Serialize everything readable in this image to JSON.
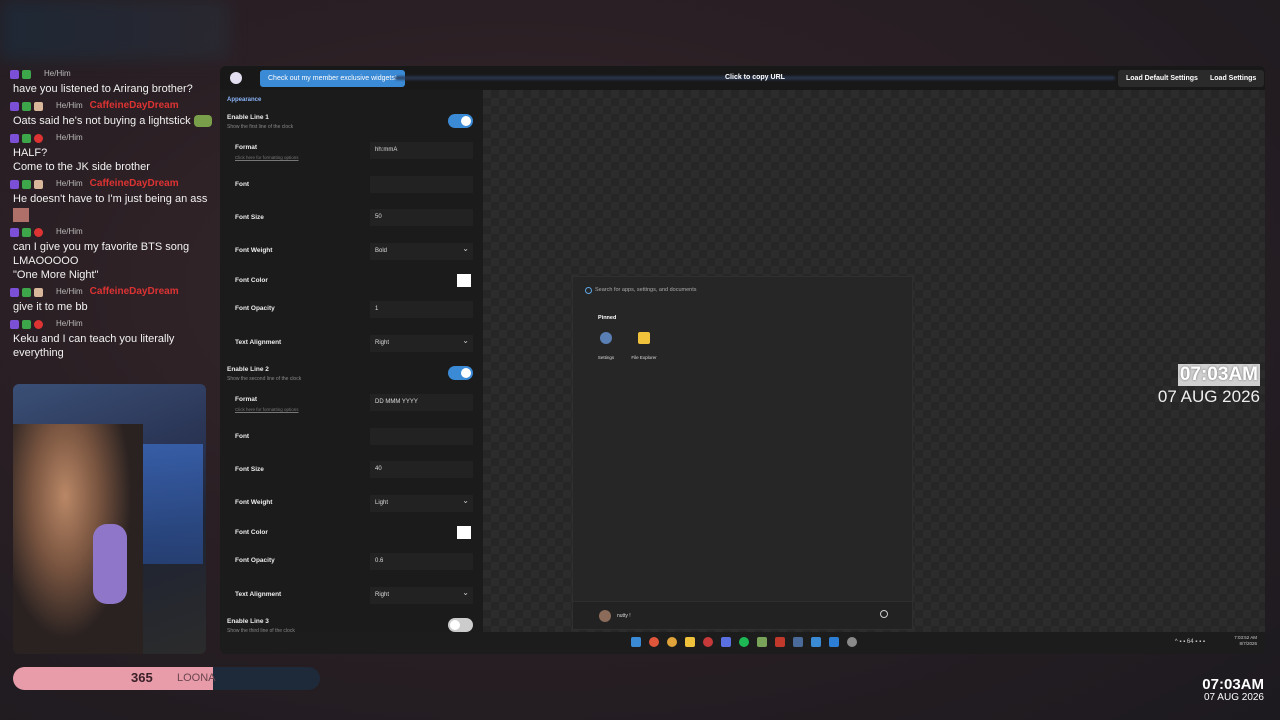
{
  "chat": [
    {
      "user": "",
      "pronoun": "He/Him",
      "badges": [
        "purple",
        "green"
      ],
      "text": "have you listened to Arirang brother?",
      "emote": false
    },
    {
      "user": "CaffeineDayDream",
      "pronoun": "He/Him",
      "badges": [
        "purple",
        "green",
        "cup"
      ],
      "text": "Oats said he's not buying a lightstick",
      "emote": true
    },
    {
      "user": "",
      "pronoun": "He/Him",
      "badges": [
        "purple",
        "green",
        "cross"
      ],
      "text": "HALF?",
      "extra": "Come to the JK side brother"
    },
    {
      "user": "CaffeineDayDream",
      "pronoun": "He/Him",
      "badges": [
        "purple",
        "green",
        "cup"
      ],
      "text": "He doesn't have to I'm just being an ass"
    },
    {
      "user": "",
      "pronoun": "He/Him",
      "badges": [
        "purple",
        "green",
        "cross"
      ],
      "text": "can I give you my favorite BTS song",
      "extra": "LMAOOOOO",
      "extra2": "\"One More Night\""
    },
    {
      "user": "CaffeineDayDream",
      "pronoun": "He/Him",
      "badges": [
        "purple",
        "green",
        "cup"
      ],
      "text": "give it to me bb"
    },
    {
      "user": "",
      "pronoun": "He/Him",
      "badges": [
        "purple",
        "green",
        "cross"
      ],
      "text": "Keku and I can teach you literally everything"
    }
  ],
  "progress": {
    "count": "365",
    "label": "LOONA",
    "fill_fraction": 0.65
  },
  "window": {
    "promo_button": "Check out my member exclusive widgets!",
    "copy_url": "Click to copy URL",
    "load_default": "Load Default Settings",
    "load_settings": "Load Settings"
  },
  "settings": {
    "section": "Appearance",
    "line1": {
      "title": "Enable Line 1",
      "desc": "Show the first line of the clock",
      "format_label": "Format",
      "format_link": "Click here for formatting options",
      "format_value": "hh:mmA",
      "font_label": "Font",
      "font_value": "",
      "size_label": "Font Size",
      "size_value": "50",
      "weight_label": "Font Weight",
      "weight_value": "Bold",
      "color_label": "Font Color",
      "opacity_label": "Font Opacity",
      "opacity_value": "1",
      "align_label": "Text Alignment",
      "align_value": "Right"
    },
    "line2": {
      "title": "Enable Line 2",
      "desc": "Show the second line of the clock",
      "format_label": "Format",
      "format_link": "Click here for formatting options",
      "format_value": "DD MMM YYYY",
      "font_label": "Font",
      "font_value": "",
      "size_label": "Font Size",
      "size_value": "40",
      "weight_label": "Font Weight",
      "weight_value": "Light",
      "color_label": "Font Color",
      "opacity_label": "Font Opacity",
      "opacity_value": "0.6",
      "align_label": "Text Alignment",
      "align_value": "Right"
    },
    "line3": {
      "title": "Enable Line 3",
      "desc": "Show the third line of the clock"
    }
  },
  "start_menu": {
    "search_placeholder": "Search for apps, settings, and documents",
    "pinned": "Pinned",
    "apps": [
      {
        "name": "Settings",
        "icon": "gear-icon"
      },
      {
        "name": "File Explorer",
        "icon": "folder-icon"
      }
    ],
    "user": "nutty !"
  },
  "preview_clock": {
    "time": "07:03AM",
    "date": "07 AUG 2026"
  },
  "taskbar": {
    "tray_time": "7:03:52 AM",
    "tray_date": "8/7/2026",
    "tray_badge": "64"
  },
  "overlay_clock": {
    "time": "07:03AM",
    "date": "07 AUG 2026"
  }
}
